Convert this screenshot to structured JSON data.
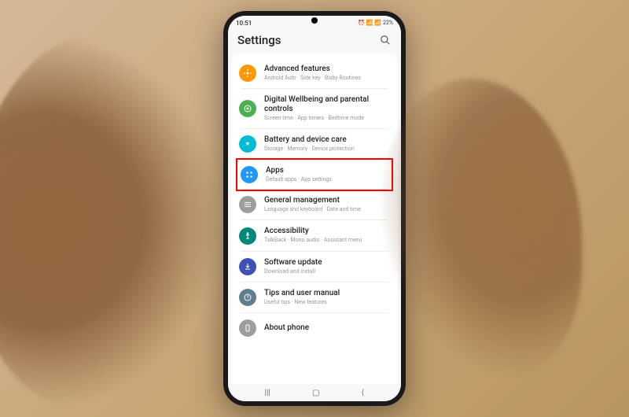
{
  "status": {
    "time": "10:51",
    "battery": "22%",
    "indicators": "⏰ 📶 📶"
  },
  "header": {
    "title": "Settings"
  },
  "items": [
    {
      "title": "Advanced features",
      "subtitle": "Android Auto · Side key · Bixby Routines",
      "color": "#ff9800"
    },
    {
      "title": "Digital Wellbeing and parental controls",
      "subtitle": "Screen time · App timers · Bedtime mode",
      "color": "#4caf50"
    },
    {
      "title": "Battery and device care",
      "subtitle": "Storage · Memory · Device protection",
      "color": "#00bcd4"
    },
    {
      "title": "Apps",
      "subtitle": "Default apps · App settings",
      "color": "#2196f3"
    },
    {
      "title": "General management",
      "subtitle": "Language and keyboard · Date and time",
      "color": "#9e9e9e"
    },
    {
      "title": "Accessibility",
      "subtitle": "TalkBack · Mono audio · Assistant menu",
      "color": "#00897b"
    },
    {
      "title": "Software update",
      "subtitle": "Download and install",
      "color": "#3f51b5"
    },
    {
      "title": "Tips and user manual",
      "subtitle": "Useful tips · New features",
      "color": "#607d8b"
    },
    {
      "title": "About phone",
      "subtitle": "",
      "color": "#9e9e9e"
    }
  ]
}
